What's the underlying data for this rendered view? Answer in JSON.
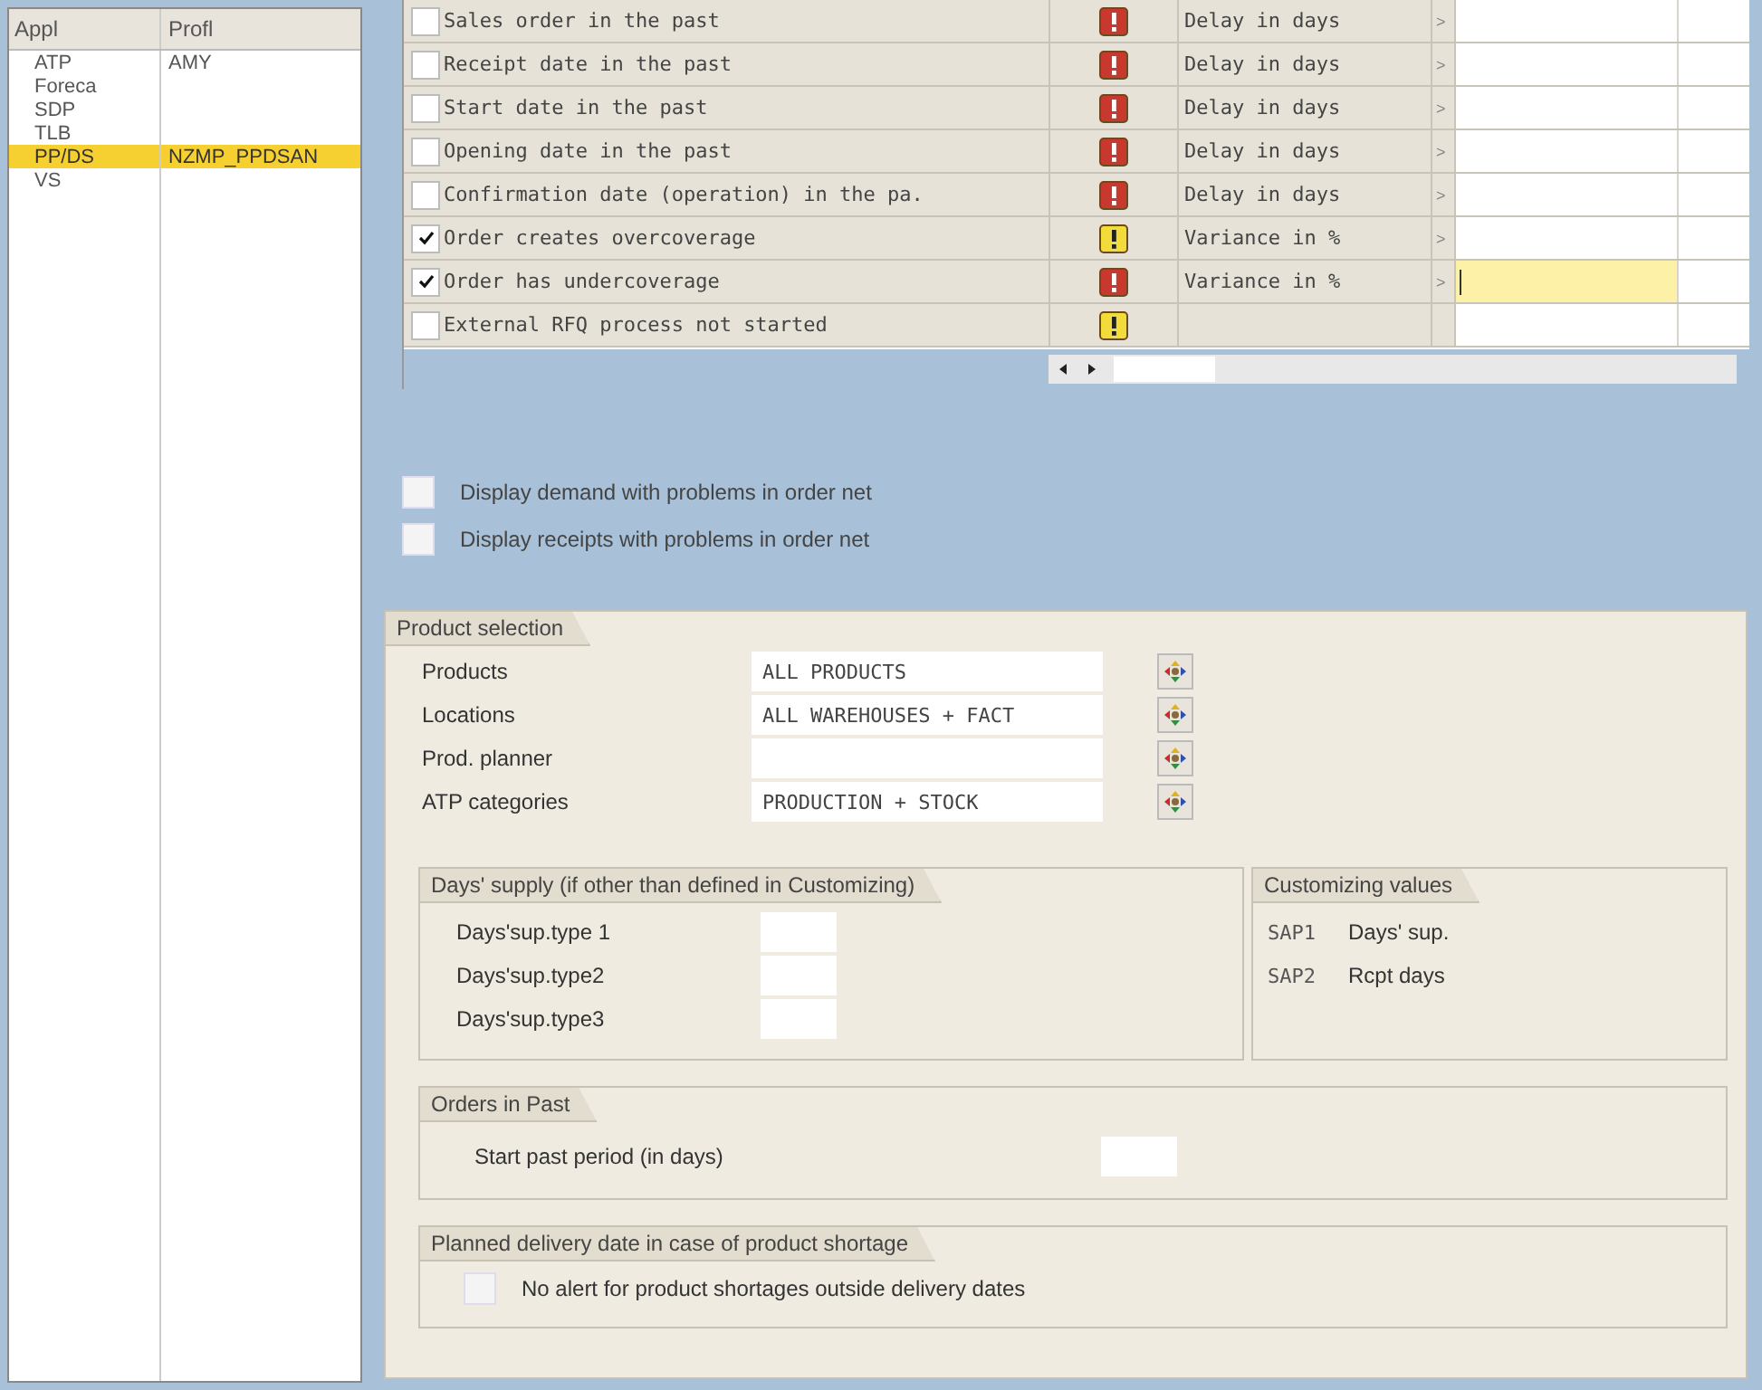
{
  "profiles": {
    "columns": [
      "Appl",
      "Profl"
    ],
    "rows": [
      {
        "appl": "ATP",
        "profile": "AMY",
        "selected": false
      },
      {
        "appl": "Foreca",
        "selected": false
      },
      {
        "appl": "SDP",
        "selected": false
      },
      {
        "appl": "TLB",
        "selected": false
      },
      {
        "appl": "PP/DS",
        "profile": "NZMP_PPDSAN",
        "selected": true
      },
      {
        "appl": "VS",
        "selected": false
      }
    ]
  },
  "alerts": [
    {
      "label": "Sales order in the past",
      "checked": false,
      "kind": "error",
      "criterion": "Delay in days",
      "arrow": ">",
      "focused": false
    },
    {
      "label": "Receipt date in the past",
      "checked": false,
      "kind": "error",
      "criterion": "Delay in days",
      "arrow": ">",
      "focused": false
    },
    {
      "label": "Start date in the past",
      "checked": false,
      "kind": "error",
      "criterion": "Delay in days",
      "arrow": ">",
      "focused": false
    },
    {
      "label": "Opening date in the past",
      "checked": false,
      "kind": "error",
      "criterion": "Delay in days",
      "arrow": ">",
      "focused": false
    },
    {
      "label": "Confirmation date (operation) in the pa.",
      "checked": false,
      "kind": "error",
      "criterion": "Delay in days",
      "arrow": ">",
      "focused": false
    },
    {
      "label": "Order creates overcoverage",
      "checked": true,
      "kind": "warning",
      "criterion": "Variance in %",
      "arrow": ">",
      "focused": false
    },
    {
      "label": "Order has undercoverage",
      "checked": true,
      "kind": "error",
      "criterion": "Variance in %",
      "arrow": ">",
      "focused": true
    },
    {
      "label": "External RFQ process not started",
      "checked": false,
      "kind": "warning",
      "focused": false
    }
  ],
  "order_net_options": [
    {
      "label": "Display demand with problems in order net",
      "checked": false
    },
    {
      "label": "Display receipts with problems in order net",
      "checked": false
    }
  ],
  "product_selection": {
    "title": "Product selection",
    "fields": [
      {
        "label": "Products",
        "value": "ALL PRODUCTS"
      },
      {
        "label": "Locations",
        "value": "ALL WAREHOUSES + FACT"
      },
      {
        "label": "Prod. planner"
      },
      {
        "label": "ATP categories",
        "value": "PRODUCTION + STOCK"
      }
    ]
  },
  "days_supply": {
    "title": "Days' supply (if other than defined in Customizing)",
    "fields": [
      "Days'sup.type 1",
      "Days'sup.type2",
      "Days'sup.type3"
    ]
  },
  "customizing_values": {
    "title": "Customizing values",
    "rows": [
      {
        "code": "SAP1",
        "text": "Days' sup."
      },
      {
        "code": "SAP2",
        "text": "Rcpt days"
      }
    ]
  },
  "orders_in_past": {
    "title": "Orders in Past",
    "field": "Start past period (in days)"
  },
  "planned_delivery": {
    "title": "Planned delivery date in case of product shortage",
    "option": {
      "label": "No alert for product shortages outside delivery dates",
      "checked": false
    }
  }
}
